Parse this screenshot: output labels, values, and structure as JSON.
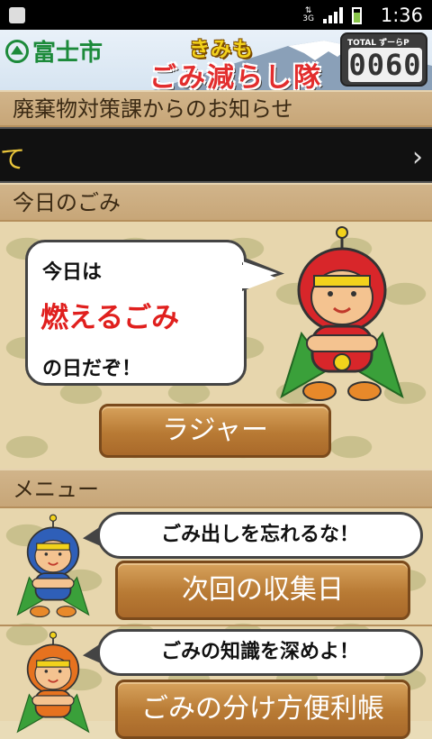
{
  "status_bar": {
    "time": "1:36",
    "network": "3G"
  },
  "header": {
    "logo_text": "富士市",
    "title_top": "きみも",
    "title_main": "ごみ減らし隊",
    "counter_label": "TOTAL ずーらP",
    "counter_value": "0060"
  },
  "notice": {
    "heading": "廃棄物対策課からのお知らせ",
    "ticker_text": "て",
    "arrow": "›"
  },
  "today": {
    "heading": "今日のごみ",
    "line1": "今日は",
    "garbage_type": "燃えるごみ",
    "line3": "の日だぞ！",
    "type_button": "ラジャー"
  },
  "menu": {
    "heading": "メニュー",
    "items": [
      {
        "speech": "ごみ出しを忘れるな！",
        "button": "次回の収集日",
        "hero_color": "#2f5fb8"
      },
      {
        "speech": "ごみの知識を深めよ！",
        "button": "ごみの分け方便利帳",
        "hero_color": "#e6721f"
      }
    ]
  },
  "colors": {
    "red_hero": "#d8262a",
    "accent_red": "#e0201e",
    "logo_green": "#1c8a3a"
  }
}
